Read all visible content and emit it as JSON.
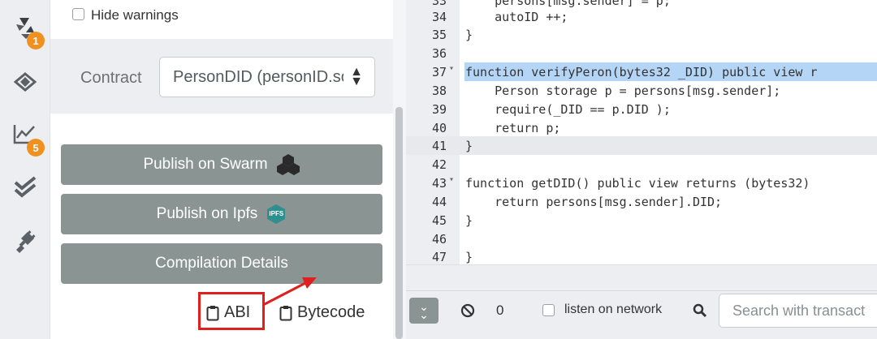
{
  "rail": {
    "compile_badge": "1",
    "analysis_badge": "5"
  },
  "panel": {
    "hide_warnings_label": "Hide warnings",
    "contract_label": "Contract",
    "contract_selected": "PersonDID (personID.so",
    "publish_swarm_label": "Publish on Swarm",
    "publish_ipfs_label": "Publish on Ipfs",
    "ipfs_icon_text": "IPFS",
    "compilation_details_label": "Compilation Details",
    "abi_label": "ABI",
    "bytecode_label": "Bytecode"
  },
  "editor": {
    "lines": [
      {
        "n": "33",
        "code": "    persons[msg.sender] = p;"
      },
      {
        "n": "34",
        "code": "    autoID ++;"
      },
      {
        "n": "35",
        "code": "}"
      },
      {
        "n": "36",
        "code": ""
      },
      {
        "n": "37",
        "code": "function verifyPeron(bytes32 _DID) public view r"
      },
      {
        "n": "38",
        "code": "    Person storage p = persons[msg.sender];"
      },
      {
        "n": "39",
        "code": "    require(_DID == p.DID );"
      },
      {
        "n": "40",
        "code": "    return p;"
      },
      {
        "n": "41",
        "code": "}"
      },
      {
        "n": "42",
        "code": ""
      },
      {
        "n": "43",
        "code": "function getDID() public view returns (bytes32)"
      },
      {
        "n": "44",
        "code": "    return persons[msg.sender].DID;"
      },
      {
        "n": "45",
        "code": "}"
      },
      {
        "n": "46",
        "code": ""
      },
      {
        "n": "47",
        "code": "}"
      }
    ]
  },
  "terminal": {
    "count": "0",
    "listen_label": "listen on network",
    "search_placeholder": "Search with transact"
  },
  "colors": {
    "accent_orange": "#f0901f",
    "button_gray": "#8a9593",
    "highlight_red": "#e0201e",
    "line_highlight": "#b4d5f5"
  }
}
